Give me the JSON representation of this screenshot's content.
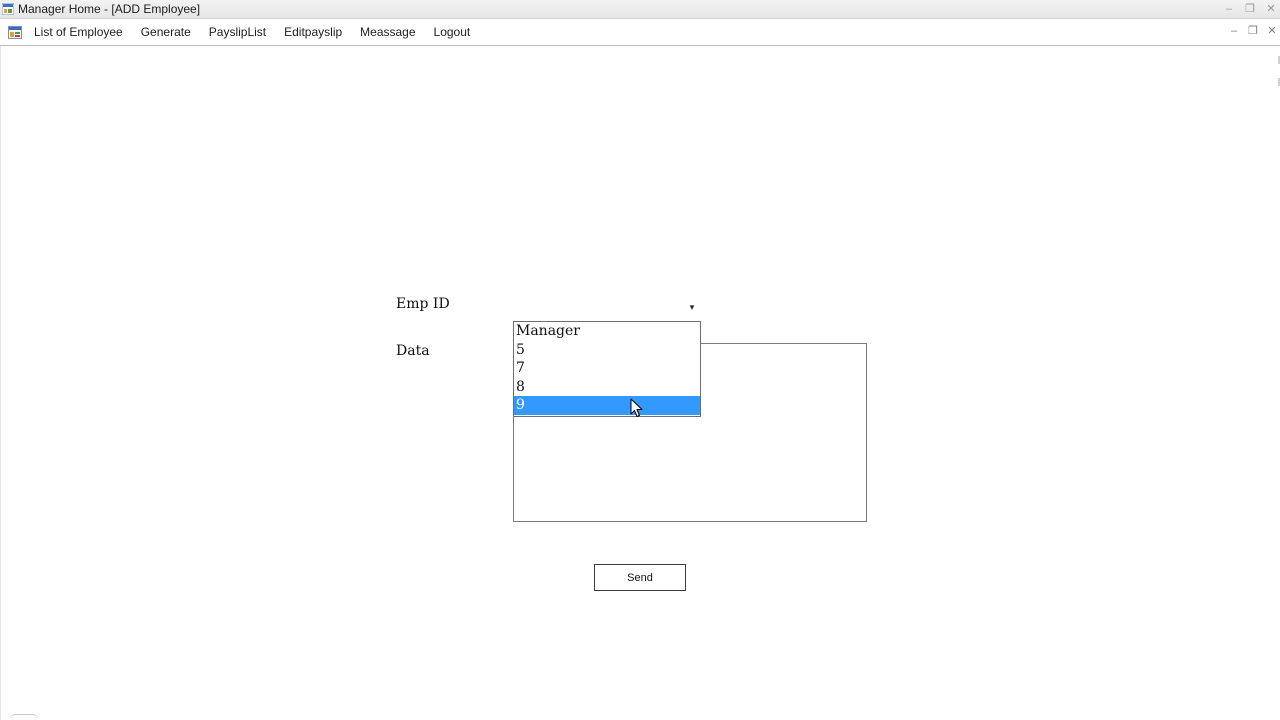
{
  "window": {
    "title": "Manager Home - [ADD Employee]",
    "icon": "app-window-icon",
    "controls": {
      "minimize": "–",
      "restore": "❐",
      "close": "✕"
    }
  },
  "menubar": {
    "icon": "mdi-child-icon",
    "items": [
      {
        "label": "List of Employee"
      },
      {
        "label": "Generate"
      },
      {
        "label": "PayslipList"
      },
      {
        "label": "Editpayslip"
      },
      {
        "label": "Meassage"
      },
      {
        "label": "Logout"
      }
    ],
    "child_controls": {
      "minimize": "–",
      "restore": "❐",
      "close": "✕"
    }
  },
  "form": {
    "emp_id_label": "Emp ID",
    "emp_id_combo": {
      "arrow": "▾",
      "options": [
        "Manager",
        "5",
        "7",
        "8",
        "9"
      ],
      "highlighted": "9"
    },
    "data_label": "Data",
    "data_value": "",
    "send_label": "Send"
  },
  "colors": {
    "selection": "#3399ff",
    "menubar_border": "#bdbdbd"
  }
}
